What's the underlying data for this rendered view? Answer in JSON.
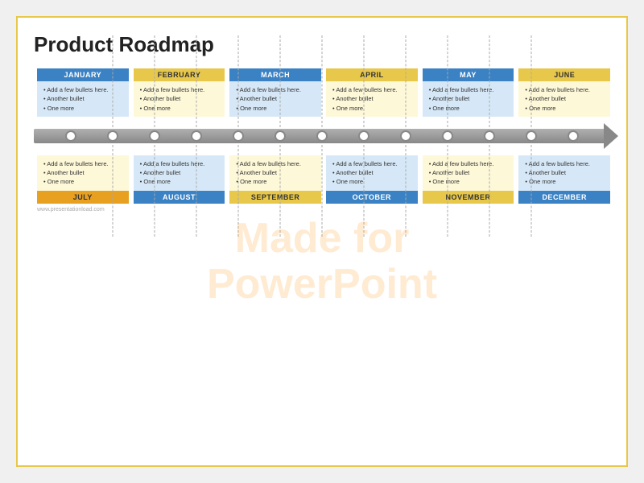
{
  "title": "Product Roadmap",
  "watermark": [
    "Made for",
    "PowerPoint"
  ],
  "top_months": [
    {
      "label": "JANUARY",
      "header_color": "blue",
      "body_color": "light-blue",
      "bullets": [
        "Add a few bullets here.",
        "Another bullet",
        "One more"
      ]
    },
    {
      "label": "FEBRUARY",
      "header_color": "yellow",
      "body_color": "light-yellow",
      "bullets": [
        "Add a few bullets here.",
        "Another bullet",
        "One more"
      ]
    },
    {
      "label": "MARCH",
      "header_color": "blue",
      "body_color": "light-blue",
      "bullets": [
        "Add a few bullets here.",
        "Another bullet",
        "One more"
      ]
    },
    {
      "label": "APRIL",
      "header_color": "yellow",
      "body_color": "light-yellow",
      "bullets": [
        "Add a few bullets here.",
        "Another bullet",
        "One more"
      ]
    },
    {
      "label": "MAY",
      "header_color": "blue",
      "body_color": "light-blue",
      "bullets": [
        "Add a few bullets here.",
        "Another bullet",
        "One more"
      ]
    },
    {
      "label": "JUNE",
      "header_color": "yellow",
      "body_color": "light-yellow",
      "bullets": [
        "Add a few bullets here.",
        "Another bullet",
        "One more"
      ]
    }
  ],
  "bottom_months": [
    {
      "label": "JULY",
      "header_color": "orange",
      "body_color": "light-yellow",
      "bullets": [
        "Add a few bullets here.",
        "Another bullet",
        "One more"
      ]
    },
    {
      "label": "AUGUST",
      "header_color": "blue",
      "body_color": "light-blue",
      "bullets": [
        "Add a few bullets here.",
        "Another bullet",
        "One more"
      ]
    },
    {
      "label": "SEPTEMBER",
      "header_color": "yellow",
      "body_color": "light-yellow",
      "bullets": [
        "Add a few bullets here.",
        "Another bullet",
        "One more"
      ]
    },
    {
      "label": "OCTOBER",
      "header_color": "blue",
      "body_color": "light-blue",
      "bullets": [
        "Add a few bullets here.",
        "Another bullet",
        "One more"
      ]
    },
    {
      "label": "NOVEMBER",
      "header_color": "yellow",
      "body_color": "light-yellow",
      "bullets": [
        "Add a few bullets here.",
        "Another bullet",
        "One more"
      ]
    },
    {
      "label": "DECEMBER",
      "header_color": "blue",
      "body_color": "light-blue",
      "bullets": [
        "Add a few bullets here.",
        "Another bullet",
        "One more"
      ]
    }
  ],
  "footer": "www.presentationload.com"
}
